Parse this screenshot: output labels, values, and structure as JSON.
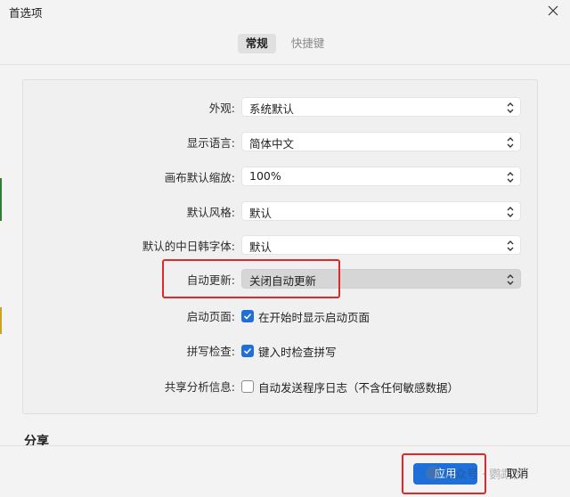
{
  "window": {
    "title": "首选项"
  },
  "tabs": [
    {
      "label": "常规",
      "active": true
    },
    {
      "label": "快捷键",
      "active": false
    }
  ],
  "settings": {
    "appearance": {
      "label": "外观:",
      "value": "系统默认"
    },
    "language": {
      "label": "显示语言:",
      "value": "简体中文"
    },
    "canvas_zoom": {
      "label": "画布默认缩放:",
      "value": "100%"
    },
    "default_style": {
      "label": "默认风格:",
      "value": "默认"
    },
    "cjk_font": {
      "label": "默认的中日韩字体:",
      "value": "默认"
    },
    "auto_update": {
      "label": "自动更新:",
      "value": "关闭自动更新"
    },
    "startup_page": {
      "label": "启动页面:",
      "checkbox_label": "在开始时显示启动页面",
      "checked": true
    },
    "spellcheck": {
      "label": "拼写检查:",
      "checkbox_label": "键入时检查拼写",
      "checked": true
    },
    "analytics": {
      "label": "共享分析信息:",
      "checkbox_label": "自动发送程序日志（不含任何敏感数据）",
      "checked": false
    }
  },
  "sections": {
    "share_title": "分享"
  },
  "footer": {
    "apply_label": "应用",
    "cancel_label": "取消"
  },
  "watermark": {
    "text": "公众号 · 鹦鹉侠"
  },
  "colors": {
    "accent": "#1e6fd9",
    "highlight": "#e02828"
  }
}
